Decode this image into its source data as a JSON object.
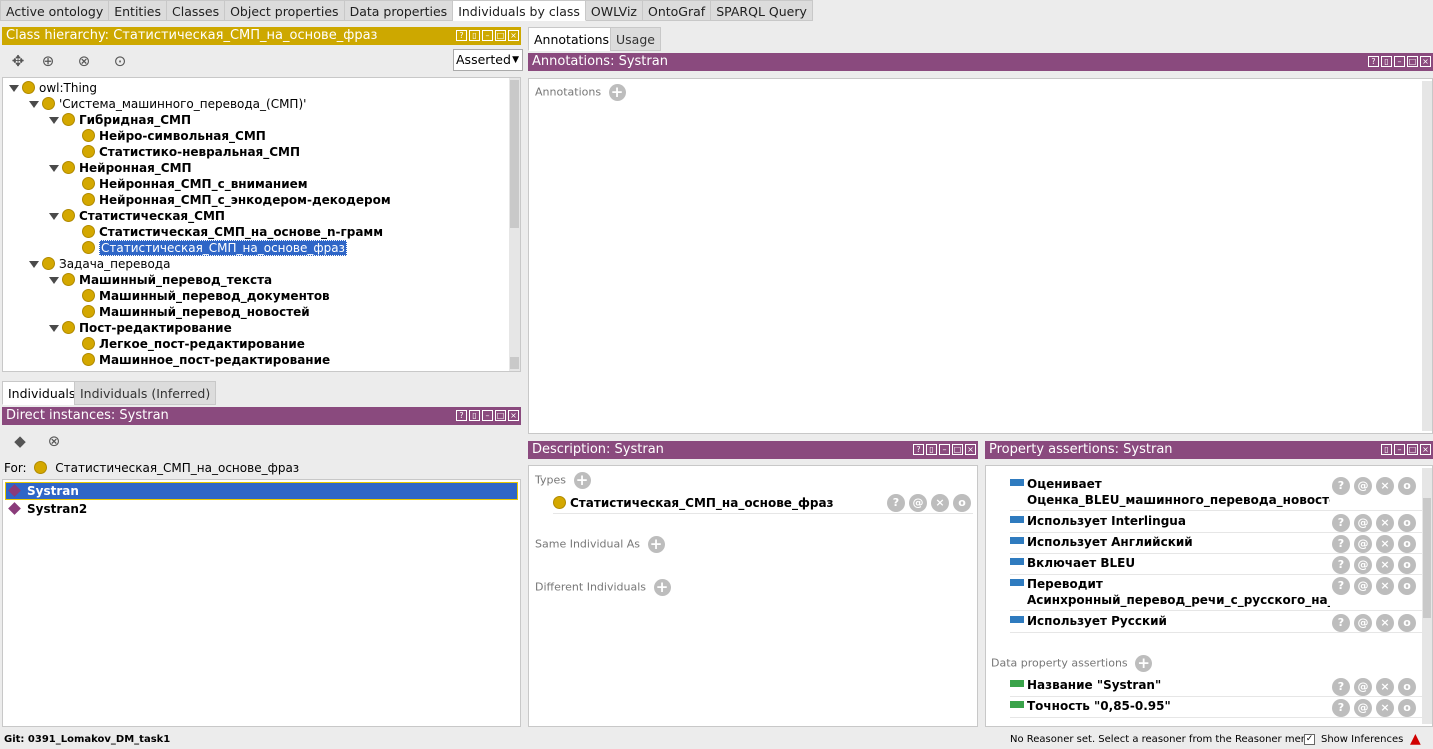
{
  "top_tabs": [
    "Active ontology",
    "Entities",
    "Classes",
    "Object properties",
    "Data properties",
    "Individuals by class",
    "OWLViz",
    "OntoGraf",
    "SPARQL Query"
  ],
  "class_hierarchy": {
    "title": "Class hierarchy: Статистическая_СМП_на_основе_фраз",
    "mode_select": "Asserted",
    "tree": [
      {
        "label": "owl:Thing",
        "level": 0,
        "expanded": true,
        "bold": false,
        "selected": false
      },
      {
        "label": "'Система_машинного_перевода_(СМП)'",
        "level": 1,
        "expanded": true,
        "bold": false,
        "selected": false
      },
      {
        "label": "Гибридная_СМП",
        "level": 2,
        "expanded": true,
        "bold": true,
        "selected": false
      },
      {
        "label": "Нейро-символьная_СМП",
        "level": 3,
        "expanded": false,
        "bold": true,
        "selected": false
      },
      {
        "label": "Статистико-невральная_СМП",
        "level": 3,
        "expanded": false,
        "bold": true,
        "selected": false
      },
      {
        "label": "Нейронная_СМП",
        "level": 2,
        "expanded": true,
        "bold": true,
        "selected": false
      },
      {
        "label": "Нейронная_СМП_с_вниманием",
        "level": 3,
        "expanded": false,
        "bold": true,
        "selected": false
      },
      {
        "label": "Нейронная_СМП_с_энкодером-декодером",
        "level": 3,
        "expanded": false,
        "bold": true,
        "selected": false
      },
      {
        "label": "Статистическая_СМП",
        "level": 2,
        "expanded": true,
        "bold": true,
        "selected": false
      },
      {
        "label": "Статистическая_СМП_на_основе_n-грамм",
        "level": 3,
        "expanded": false,
        "bold": true,
        "selected": false
      },
      {
        "label": "Статистическая_СМП_на_основе_фраз",
        "level": 3,
        "expanded": false,
        "bold": false,
        "selected": true
      },
      {
        "label": "Задача_перевода",
        "level": 1,
        "expanded": true,
        "bold": false,
        "selected": false
      },
      {
        "label": "Машинный_перевод_текста",
        "level": 2,
        "expanded": true,
        "bold": true,
        "selected": false
      },
      {
        "label": "Машинный_перевод_документов",
        "level": 3,
        "expanded": false,
        "bold": true,
        "selected": false
      },
      {
        "label": "Машинный_перевод_новостей",
        "level": 3,
        "expanded": false,
        "bold": true,
        "selected": false
      },
      {
        "label": "Пост-редактирование",
        "level": 2,
        "expanded": true,
        "bold": true,
        "selected": false
      },
      {
        "label": "Легкое_пост-редактирование",
        "level": 3,
        "expanded": false,
        "bold": true,
        "selected": false
      },
      {
        "label": "Машинное_пост-редактирование",
        "level": 3,
        "expanded": false,
        "bold": true,
        "selected": false
      }
    ]
  },
  "individuals_tabs": [
    "Individuals",
    "Individuals (Inferred)"
  ],
  "direct_instances": {
    "title": "Direct instances: Systran",
    "for_label": "For:",
    "for_class": "Статистическая_СМП_на_основе_фраз",
    "items": [
      {
        "label": "Systran",
        "selected": true
      },
      {
        "label": "Systran2",
        "selected": false
      }
    ]
  },
  "right_tabs": [
    "Annotations",
    "Usage"
  ],
  "annotations": {
    "title": "Annotations: Systran",
    "section_label": "Annotations"
  },
  "description": {
    "title": "Description: Systran",
    "types_label": "Types",
    "types": [
      "Статистическая_СМП_на_основе_фраз"
    ],
    "same_label": "Same Individual As",
    "different_label": "Different Individuals"
  },
  "property_assertions": {
    "title": "Property assertions: Systran",
    "object_props": [
      {
        "line1": "Оценивает",
        "line2": "Оценка_BLEU_машинного_перевода_новостей_с_а"
      },
      {
        "line1": "Использует  Interlingua",
        "line2": ""
      },
      {
        "line1": "Использует  Английский",
        "line2": ""
      },
      {
        "line1": "Включает  BLEU",
        "line2": ""
      },
      {
        "line1": "Переводит",
        "line2": "Асинхронный_перевод_речи_с_русского_на_англи"
      },
      {
        "line1": "Использует  Русский",
        "line2": ""
      }
    ],
    "data_label": "Data property assertions",
    "data_props": [
      {
        "line1": "Название  \"Systran\""
      },
      {
        "line1": "Точность  \"0,85-0.95\""
      }
    ]
  },
  "status": {
    "left": "Git: 0391_Lomakov_DM_task1",
    "reasoner": "No Reasoner set. Select a reasoner from the Reasoner menu",
    "show_inferences": "Show Inferences"
  },
  "colors": {
    "class_header": "#cda800",
    "entity_header": "#8a4a7e",
    "selection": "#2f66c7"
  }
}
